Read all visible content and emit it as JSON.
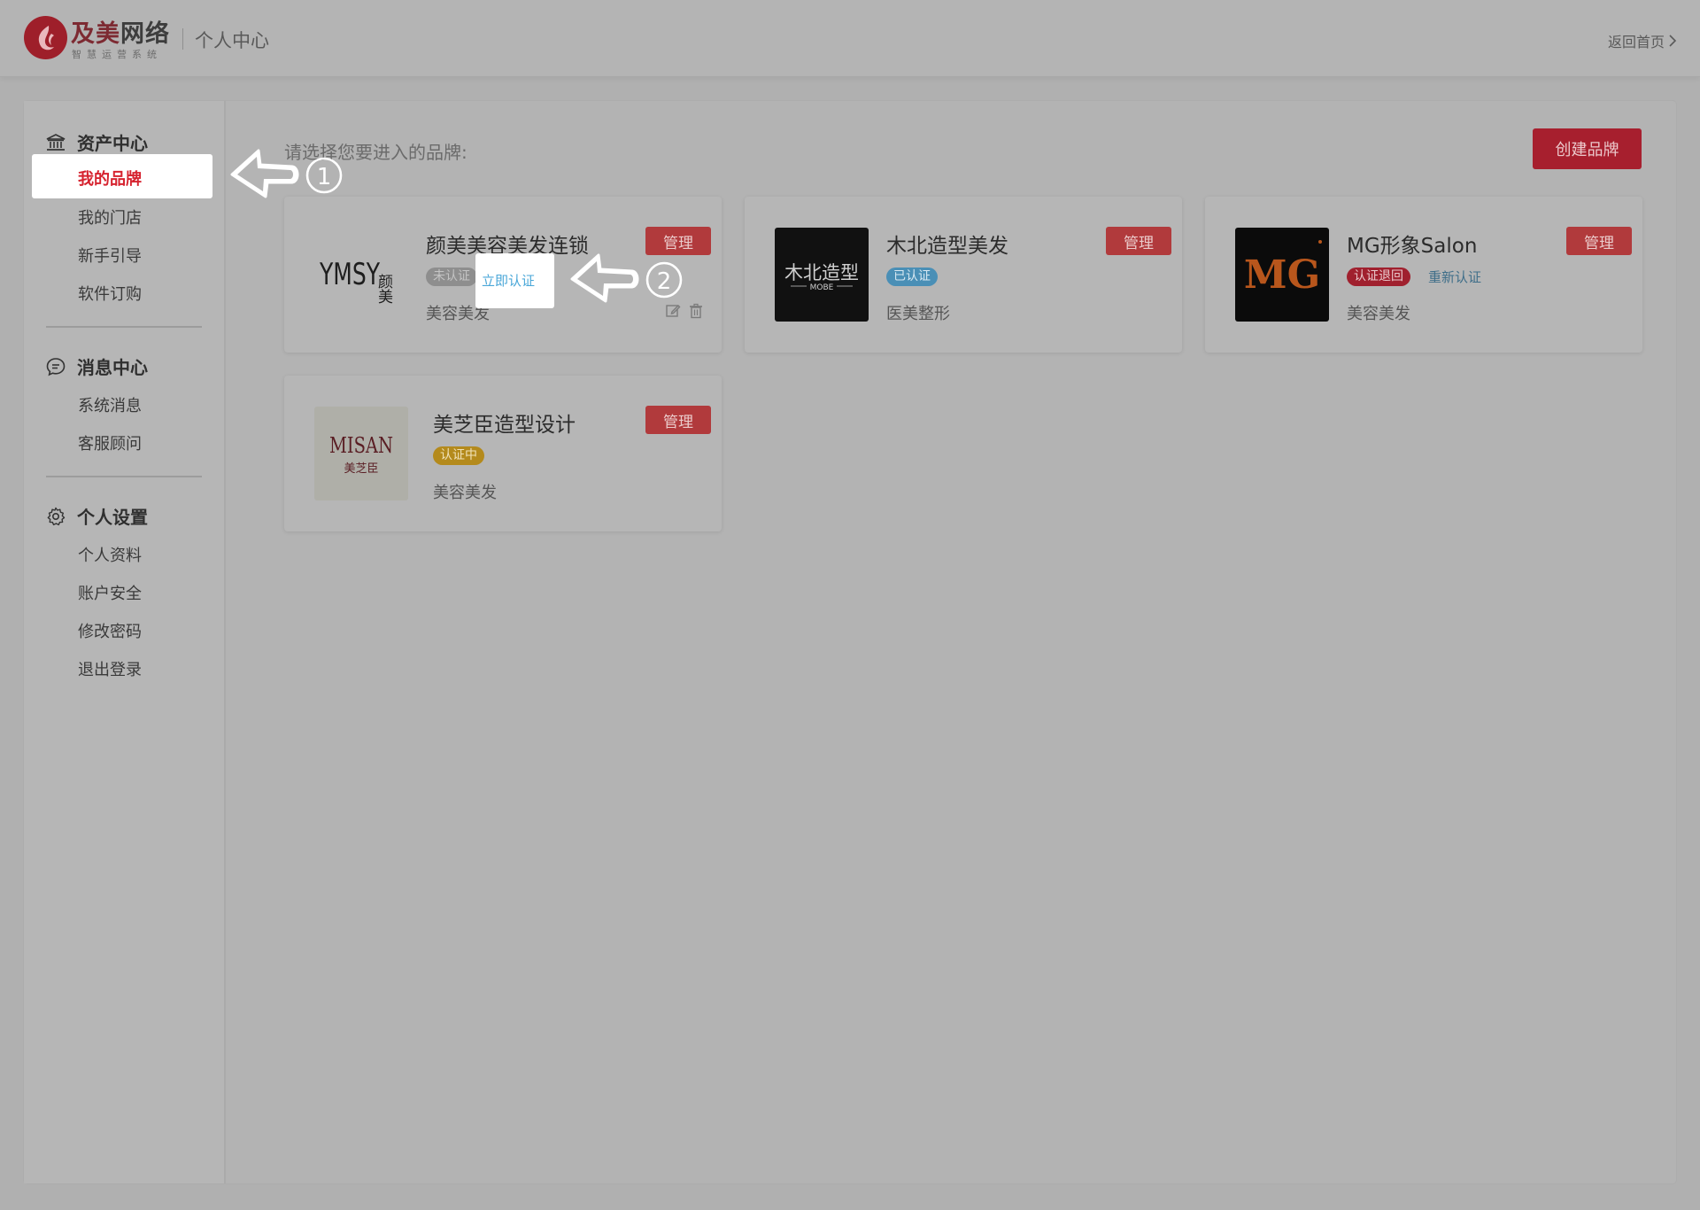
{
  "header": {
    "logo_main": "及美",
    "logo_tail": "网络",
    "logo_sub": "智慧运营系统",
    "title": "个人中心",
    "back_home": "返回首页"
  },
  "sidebar": {
    "groups": [
      {
        "title": "资产中心",
        "icon": "bank-icon",
        "items": [
          "我的品牌",
          "我的门店",
          "新手引导",
          "软件订购"
        ]
      },
      {
        "title": "消息中心",
        "icon": "chat-bubble-icon",
        "items": [
          "系统消息",
          "客服顾问"
        ]
      },
      {
        "title": "个人设置",
        "icon": "gear-icon",
        "items": [
          "个人资料",
          "账户安全",
          "修改密码",
          "退出登录"
        ]
      }
    ],
    "active_item": "我的品牌"
  },
  "main": {
    "prompt": "请选择您要进入的品牌:",
    "create_button": "创建品牌",
    "manage_label": "管理",
    "cards": [
      {
        "name": "颜美美容美发连锁",
        "badge": "未认证",
        "badge_color": "#8e8e8e",
        "action": "立即认证",
        "industry": "美容美发",
        "logo_text": "YMSY",
        "logo_cn": "颜美"
      },
      {
        "name": "木北造型美发",
        "badge": "已认证",
        "badge_color": "#4a8fb6",
        "industry": "医美整形",
        "logo_text": "木北造型",
        "logo_sub": "MOBE"
      },
      {
        "name": "MG形象Salon",
        "badge": "认证退回",
        "badge_color": "#a0202e",
        "action": "重新认证",
        "industry": "美容美发",
        "logo_text": "MG"
      },
      {
        "name": "美芝臣造型设计",
        "badge": "认证中",
        "badge_color": "#b48a1c",
        "industry": "美容美发",
        "logo_text": "MISAN",
        "logo_cn": "美芝臣"
      }
    ]
  },
  "guide": {
    "step1": "①",
    "step2": "②"
  },
  "colors": {
    "accent": "#d6232f",
    "create_button": "#a71f2e",
    "manage_button": "#b13a3c",
    "link": "#4aa7d8"
  }
}
